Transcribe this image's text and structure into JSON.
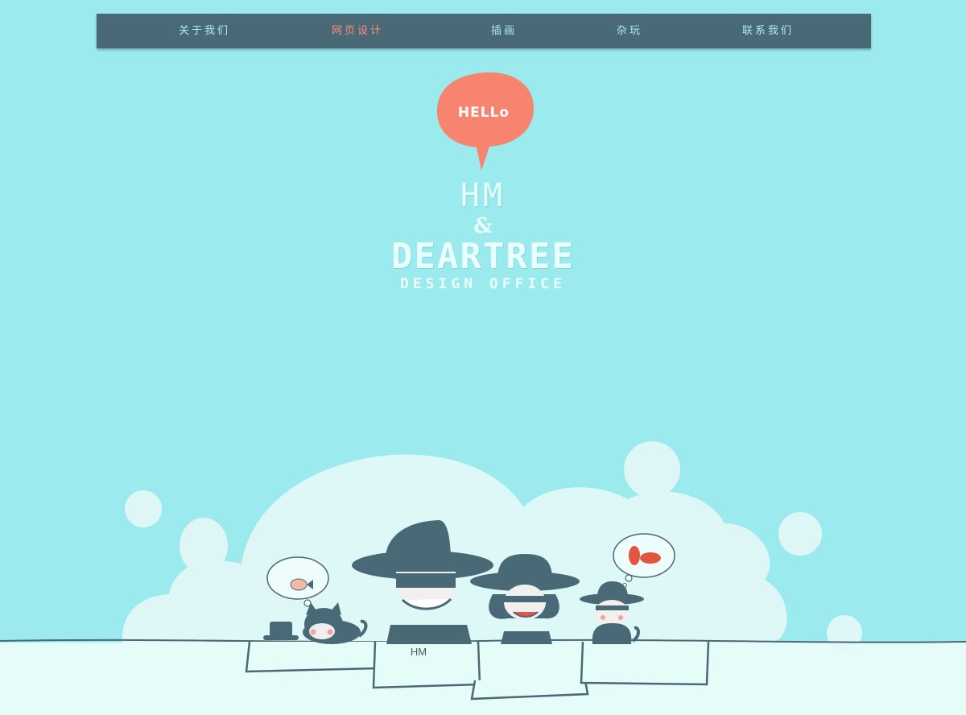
{
  "nav": {
    "items": [
      {
        "label": "关于我们",
        "active": false
      },
      {
        "label": "网页设计",
        "active": true
      },
      {
        "label": "插画",
        "active": false
      },
      {
        "label": "杂玩",
        "active": false
      },
      {
        "label": "联系我们",
        "active": false
      }
    ]
  },
  "bubble": {
    "text": "HELLo",
    "color": "#f7846e"
  },
  "logo": {
    "line1": "HM",
    "line2": "&",
    "line3": "DEARTREE",
    "line4": "DESIGN OFFICE"
  },
  "boxes": {
    "label": "HM"
  },
  "colors": {
    "background": "#9bebee",
    "nav": "#4a6977",
    "nav_text": "#a9ecef",
    "nav_active": "#ff8a73",
    "hats": "#4a6977",
    "cloud": "#e4f8f7"
  }
}
